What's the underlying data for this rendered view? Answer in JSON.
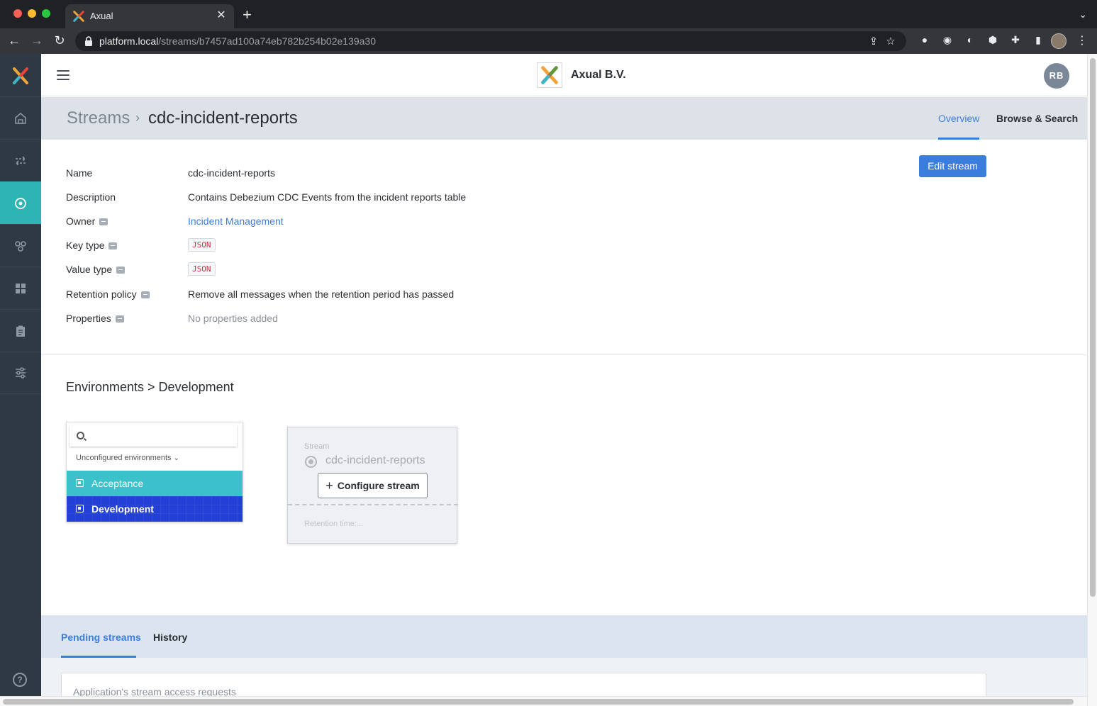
{
  "browser": {
    "tab_title": "Axual",
    "tab_close": "✕",
    "new_tab": "+",
    "url_host": "platform.local",
    "url_path": "/streams/b7457ad100a74eb782b254b02e139a30"
  },
  "header": {
    "org_name": "Axual B.V.",
    "user_initials": "RB"
  },
  "breadcrumb": {
    "root": "Streams",
    "separator": "›",
    "current": "cdc-incident-reports"
  },
  "page_tabs": [
    {
      "label": "Overview",
      "active": true
    },
    {
      "label": "Browse & Search",
      "active": false
    }
  ],
  "actions": {
    "edit_stream": "Edit stream"
  },
  "details": {
    "name_label": "Name",
    "name_value": "cdc-incident-reports",
    "description_label": "Description",
    "description_value": "Contains Debezium CDC Events from the incident reports table",
    "owner_label": "Owner",
    "owner_value": "Incident Management",
    "key_type_label": "Key type",
    "key_type_value": "JSON",
    "value_type_label": "Value type",
    "value_type_value": "JSON",
    "retention_label": "Retention policy",
    "retention_value": "Remove all messages when the retention period has passed",
    "properties_label": "Properties",
    "properties_value": "No properties added"
  },
  "environments": {
    "title": "Environments > Development",
    "search_placeholder": "",
    "filter_label": "Unconfigured environments",
    "items": [
      {
        "label": "Acceptance",
        "color": "#3bc1c9"
      },
      {
        "label": "Development",
        "color": "#2340d6"
      }
    ]
  },
  "stream_card": {
    "label": "Stream",
    "name": "cdc-incident-reports",
    "configure_button": "Configure stream",
    "retention": "Retention time:..."
  },
  "lower_tabs": [
    {
      "label": "Pending streams",
      "active": true
    },
    {
      "label": "History",
      "active": false
    }
  ],
  "requests": {
    "title": "Application's stream access requests"
  },
  "colors": {
    "accent": "#3b7ddd",
    "sidebar": "#2f3944",
    "sidebar_active": "#2db4b4"
  }
}
